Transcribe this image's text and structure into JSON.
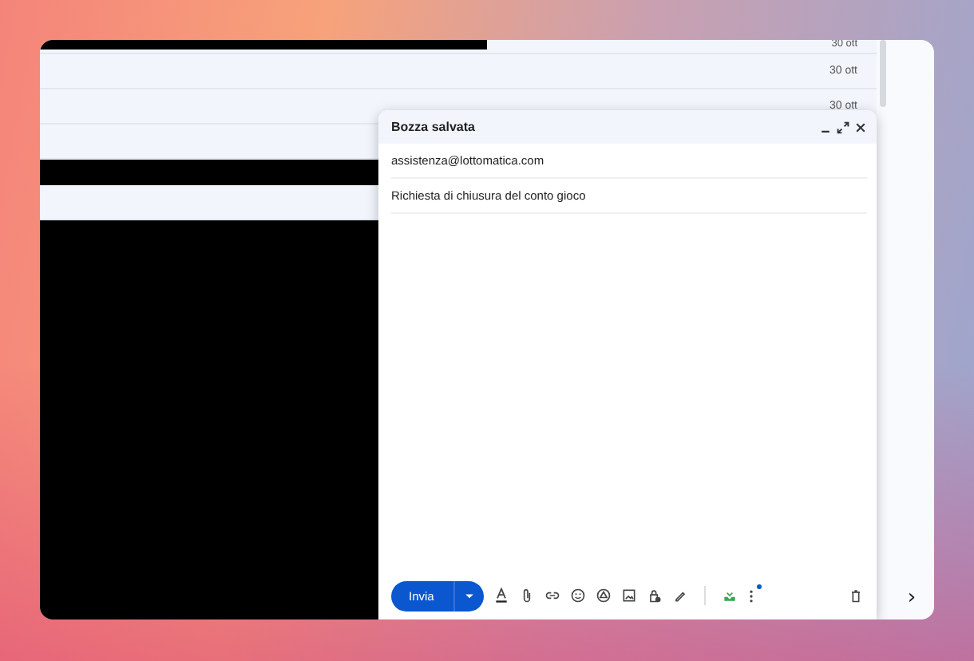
{
  "mail_list": {
    "rows": [
      {
        "kind": "redacted_mail",
        "date": "30 ott"
      },
      {
        "kind": "mail",
        "date": "30 ott"
      },
      {
        "kind": "mail",
        "date": "30 ott"
      },
      {
        "kind": "mail"
      },
      {
        "kind": "redacted"
      },
      {
        "kind": "mail"
      },
      {
        "kind": "redacted_block"
      }
    ]
  },
  "compose": {
    "title": "Bozza salvata",
    "to": "assistenza@lottomatica.com",
    "subject": "Richiesta di chiusura del conto gioco",
    "send_label": "Invia",
    "more_options_notification": true
  },
  "side_panel": {
    "expand_label": "›"
  }
}
